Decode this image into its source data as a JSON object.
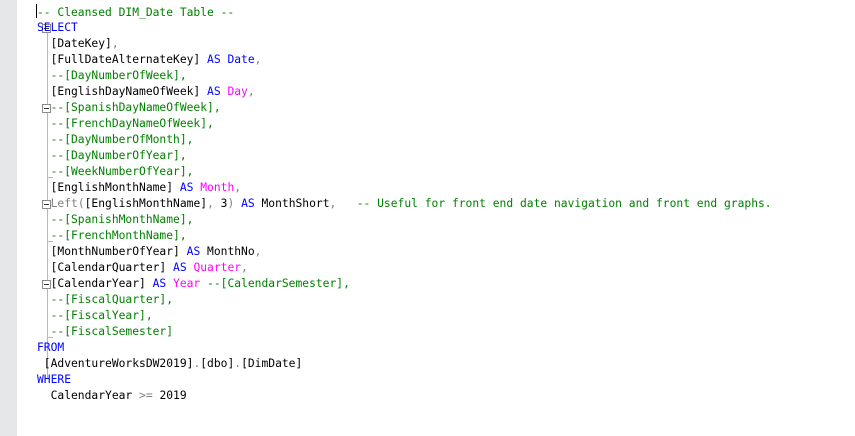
{
  "editor": {
    "lines": [
      [
        {
          "t": "-- Cleansed DIM_Date Table --",
          "c": "cm"
        }
      ],
      [
        {
          "t": "SELECT",
          "c": "kw"
        }
      ],
      [
        {
          "t": "  [DateKey]",
          "c": "id"
        },
        {
          "t": ",",
          "c": "pu"
        }
      ],
      [
        {
          "t": "  [FullDateAlternateKey] ",
          "c": "id"
        },
        {
          "t": "AS ",
          "c": "kw"
        },
        {
          "t": "Date",
          "c": "kw"
        },
        {
          "t": ",",
          "c": "pu"
        }
      ],
      [
        {
          "t": "  --[DayNumberOfWeek],",
          "c": "cm"
        }
      ],
      [
        {
          "t": "  [EnglishDayNameOfWeek] ",
          "c": "id"
        },
        {
          "t": "AS ",
          "c": "kw"
        },
        {
          "t": "Day",
          "c": "fn"
        },
        {
          "t": ",",
          "c": "pu"
        }
      ],
      [
        {
          "t": "  --[SpanishDayNameOfWeek],",
          "c": "cm"
        }
      ],
      [
        {
          "t": "  --[FrenchDayNameOfWeek],",
          "c": "cm"
        }
      ],
      [
        {
          "t": "  --[DayNumberOfMonth],",
          "c": "cm"
        }
      ],
      [
        {
          "t": "  --[DayNumberOfYear],",
          "c": "cm"
        }
      ],
      [
        {
          "t": "  --[WeekNumberOfYear],",
          "c": "cm"
        }
      ],
      [
        {
          "t": "  [EnglishMonthName] ",
          "c": "id"
        },
        {
          "t": "AS ",
          "c": "kw"
        },
        {
          "t": "Month",
          "c": "fn"
        },
        {
          "t": ",",
          "c": "pu"
        }
      ],
      [
        {
          "t": "  Left",
          "c": "fg"
        },
        {
          "t": "(",
          "c": "pu"
        },
        {
          "t": "[EnglishMonthName]",
          "c": "id"
        },
        {
          "t": ", ",
          "c": "pu"
        },
        {
          "t": "3",
          "c": "id"
        },
        {
          "t": ") ",
          "c": "pu"
        },
        {
          "t": "AS ",
          "c": "kw"
        },
        {
          "t": "MonthShort",
          "c": "id"
        },
        {
          "t": ",",
          "c": "pu"
        },
        {
          "t": "   -- Useful for front end date navigation and front end graphs.",
          "c": "cm"
        }
      ],
      [
        {
          "t": "  --[SpanishMonthName],",
          "c": "cm"
        }
      ],
      [
        {
          "t": "  --[FrenchMonthName],",
          "c": "cm"
        }
      ],
      [
        {
          "t": "  [MonthNumberOfYear] ",
          "c": "id"
        },
        {
          "t": "AS ",
          "c": "kw"
        },
        {
          "t": "MonthNo",
          "c": "id"
        },
        {
          "t": ",",
          "c": "pu"
        }
      ],
      [
        {
          "t": "  [CalendarQuarter] ",
          "c": "id"
        },
        {
          "t": "AS ",
          "c": "kw"
        },
        {
          "t": "Quarter",
          "c": "fn"
        },
        {
          "t": ",",
          "c": "pu"
        }
      ],
      [
        {
          "t": "  [CalendarYear] ",
          "c": "id"
        },
        {
          "t": "AS ",
          "c": "kw"
        },
        {
          "t": "Year",
          "c": "fn"
        },
        {
          "t": " --[CalendarSemester],",
          "c": "cm"
        }
      ],
      [
        {
          "t": "  --[FiscalQuarter],",
          "c": "cm"
        }
      ],
      [
        {
          "t": "  --[FiscalYear],",
          "c": "cm"
        }
      ],
      [
        {
          "t": "  --[FiscalSemester]",
          "c": "cm"
        }
      ],
      [
        {
          "t": "FROM",
          "c": "kw"
        }
      ],
      [
        {
          "t": " [AdventureWorksDW2019]",
          "c": "id"
        },
        {
          "t": ".",
          "c": "pu"
        },
        {
          "t": "[dbo]",
          "c": "id"
        },
        {
          "t": ".",
          "c": "pu"
        },
        {
          "t": "[DimDate]",
          "c": "id"
        }
      ],
      [
        {
          "t": "WHERE",
          "c": "kw"
        }
      ],
      [
        {
          "t": "  CalendarYear ",
          "c": "id"
        },
        {
          "t": ">=",
          "c": "pu"
        },
        {
          "t": " 2019",
          "c": "id"
        }
      ]
    ]
  }
}
